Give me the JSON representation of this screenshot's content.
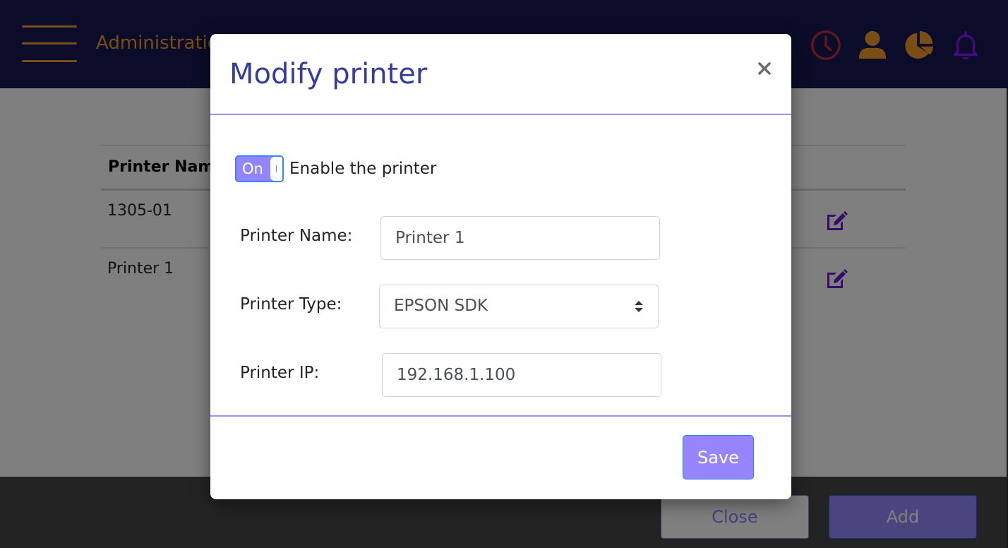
{
  "app": {
    "brand": "Administration",
    "colors": {
      "header_bg": "#141852",
      "accent_orange": "#f39a2c",
      "accent_purple": "#9785ff",
      "title_blue": "#353c99",
      "clock_red": "#c0313b",
      "bell_purple": "#8a14ff",
      "edit_purple": "#6f14d9"
    }
  },
  "header": {
    "icons": [
      {
        "name": "clock-icon"
      },
      {
        "name": "user-icon"
      },
      {
        "name": "pie-chart-icon"
      },
      {
        "name": "bell-icon"
      }
    ]
  },
  "table": {
    "columns": [
      "Printer Name"
    ],
    "rows": [
      {
        "name": "1305-01",
        "action": "edit-icon"
      },
      {
        "name": "Printer 1",
        "action": "edit-icon"
      }
    ]
  },
  "footer": {
    "close_label": "Close",
    "add_label": "Add"
  },
  "modal": {
    "title": "Modify printer",
    "close_icon": "×",
    "toggle": {
      "state_label": "On",
      "enabled": true,
      "label": "Enable the printer"
    },
    "fields": {
      "name": {
        "label": "Printer Name:",
        "value": "Printer 1"
      },
      "type": {
        "label": "Printer Type:",
        "value": "EPSON SDK"
      },
      "ip": {
        "label": "Printer IP:",
        "value": "192.168.1.100"
      }
    },
    "save_label": "Save"
  }
}
